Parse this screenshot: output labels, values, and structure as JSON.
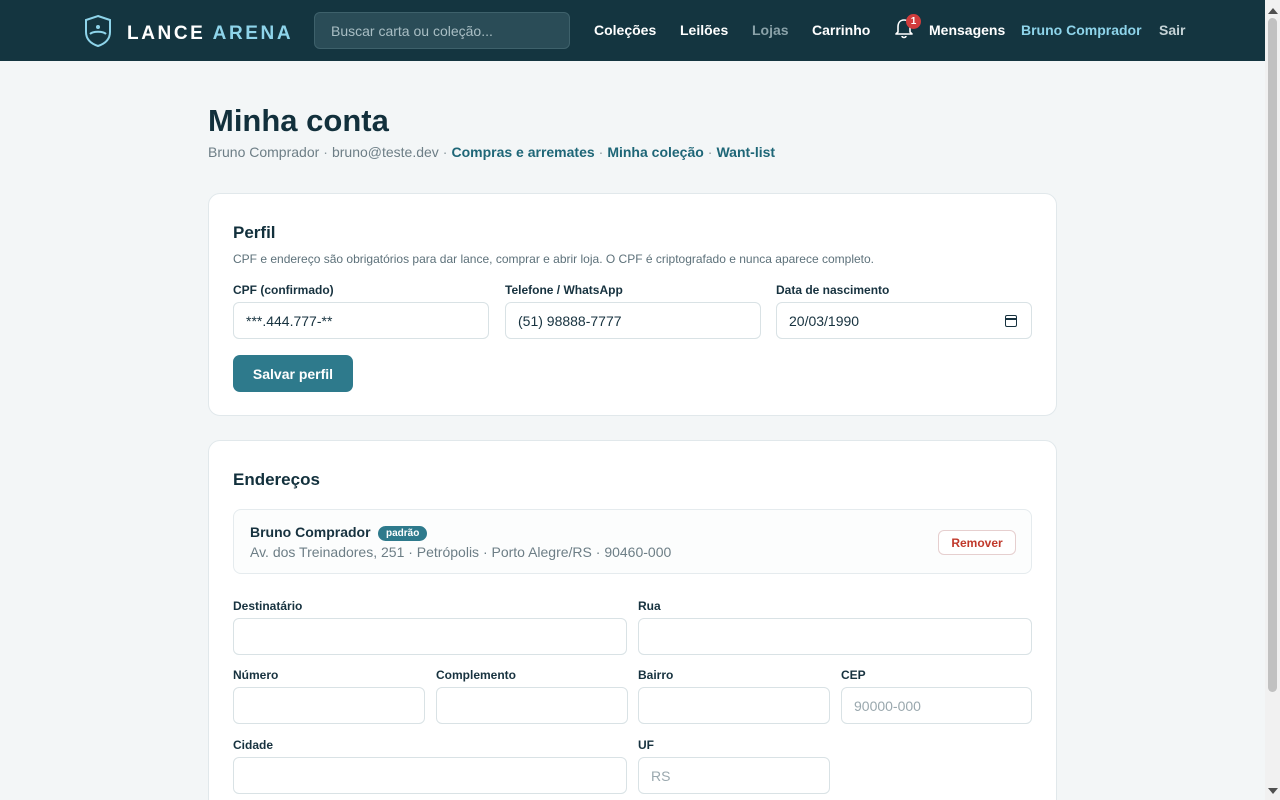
{
  "header": {
    "brand_first": "LANCE",
    "brand_second": "ARENA",
    "search_placeholder": "Buscar carta ou coleção...",
    "nav": {
      "colecoes": "Coleções",
      "leiloes": "Leilões",
      "lojas": "Lojas",
      "carrinho": "Carrinho",
      "mensagens": "Mensagens",
      "user": "Bruno Comprador",
      "logout": "Sair"
    },
    "notification_count": "1"
  },
  "page": {
    "title": "Minha conta",
    "user_name": "Bruno Comprador",
    "sep1": "·",
    "user_email": "bruno@teste.dev",
    "sep2": "·",
    "link_compras": "Compras e arremates",
    "sep3": "·",
    "link_colecao": "Minha coleção",
    "sep4": "·",
    "link_wantlist": "Want-list"
  },
  "profile": {
    "title": "Perfil",
    "description": "CPF e endereço são obrigatórios para dar lance, comprar e abrir loja. O CPF é criptografado e nunca aparece completo.",
    "cpf_label": "CPF (confirmado)",
    "cpf_value": "***.444.777-**",
    "phone_label": "Telefone / WhatsApp",
    "phone_value": "(51) 98888-7777",
    "birth_label": "Data de nascimento",
    "birth_value": "20/03/1990",
    "save_label": "Salvar perfil"
  },
  "addresses": {
    "title": "Endereços",
    "items": [
      {
        "name": "Bruno Comprador",
        "tag": "padrão",
        "line": "Av. dos Treinadores, 251 · Petrópolis · Porto Alegre/RS · 90460-000",
        "remove_label": "Remover"
      }
    ],
    "form": {
      "recipient_label": "Destinatário",
      "recipient_value": "",
      "street_label": "Rua",
      "street_value": "",
      "number_label": "Número",
      "number_value": "",
      "complement_label": "Complemento",
      "complement_value": "",
      "district_label": "Bairro",
      "district_value": "",
      "cep_label": "CEP",
      "cep_placeholder": "90000-000",
      "city_label": "Cidade",
      "city_value": "",
      "uf_label": "UF",
      "uf_placeholder": "RS"
    }
  },
  "colors": {
    "topbar": "#143540",
    "accent": "#8ed4ea",
    "primary_button": "#2e7a8c",
    "danger": "#c0392b",
    "badge": "#d13c3c"
  },
  "icons": {
    "logo": "shield-icon",
    "notifications": "bell-icon",
    "date": "calendar-icon"
  }
}
